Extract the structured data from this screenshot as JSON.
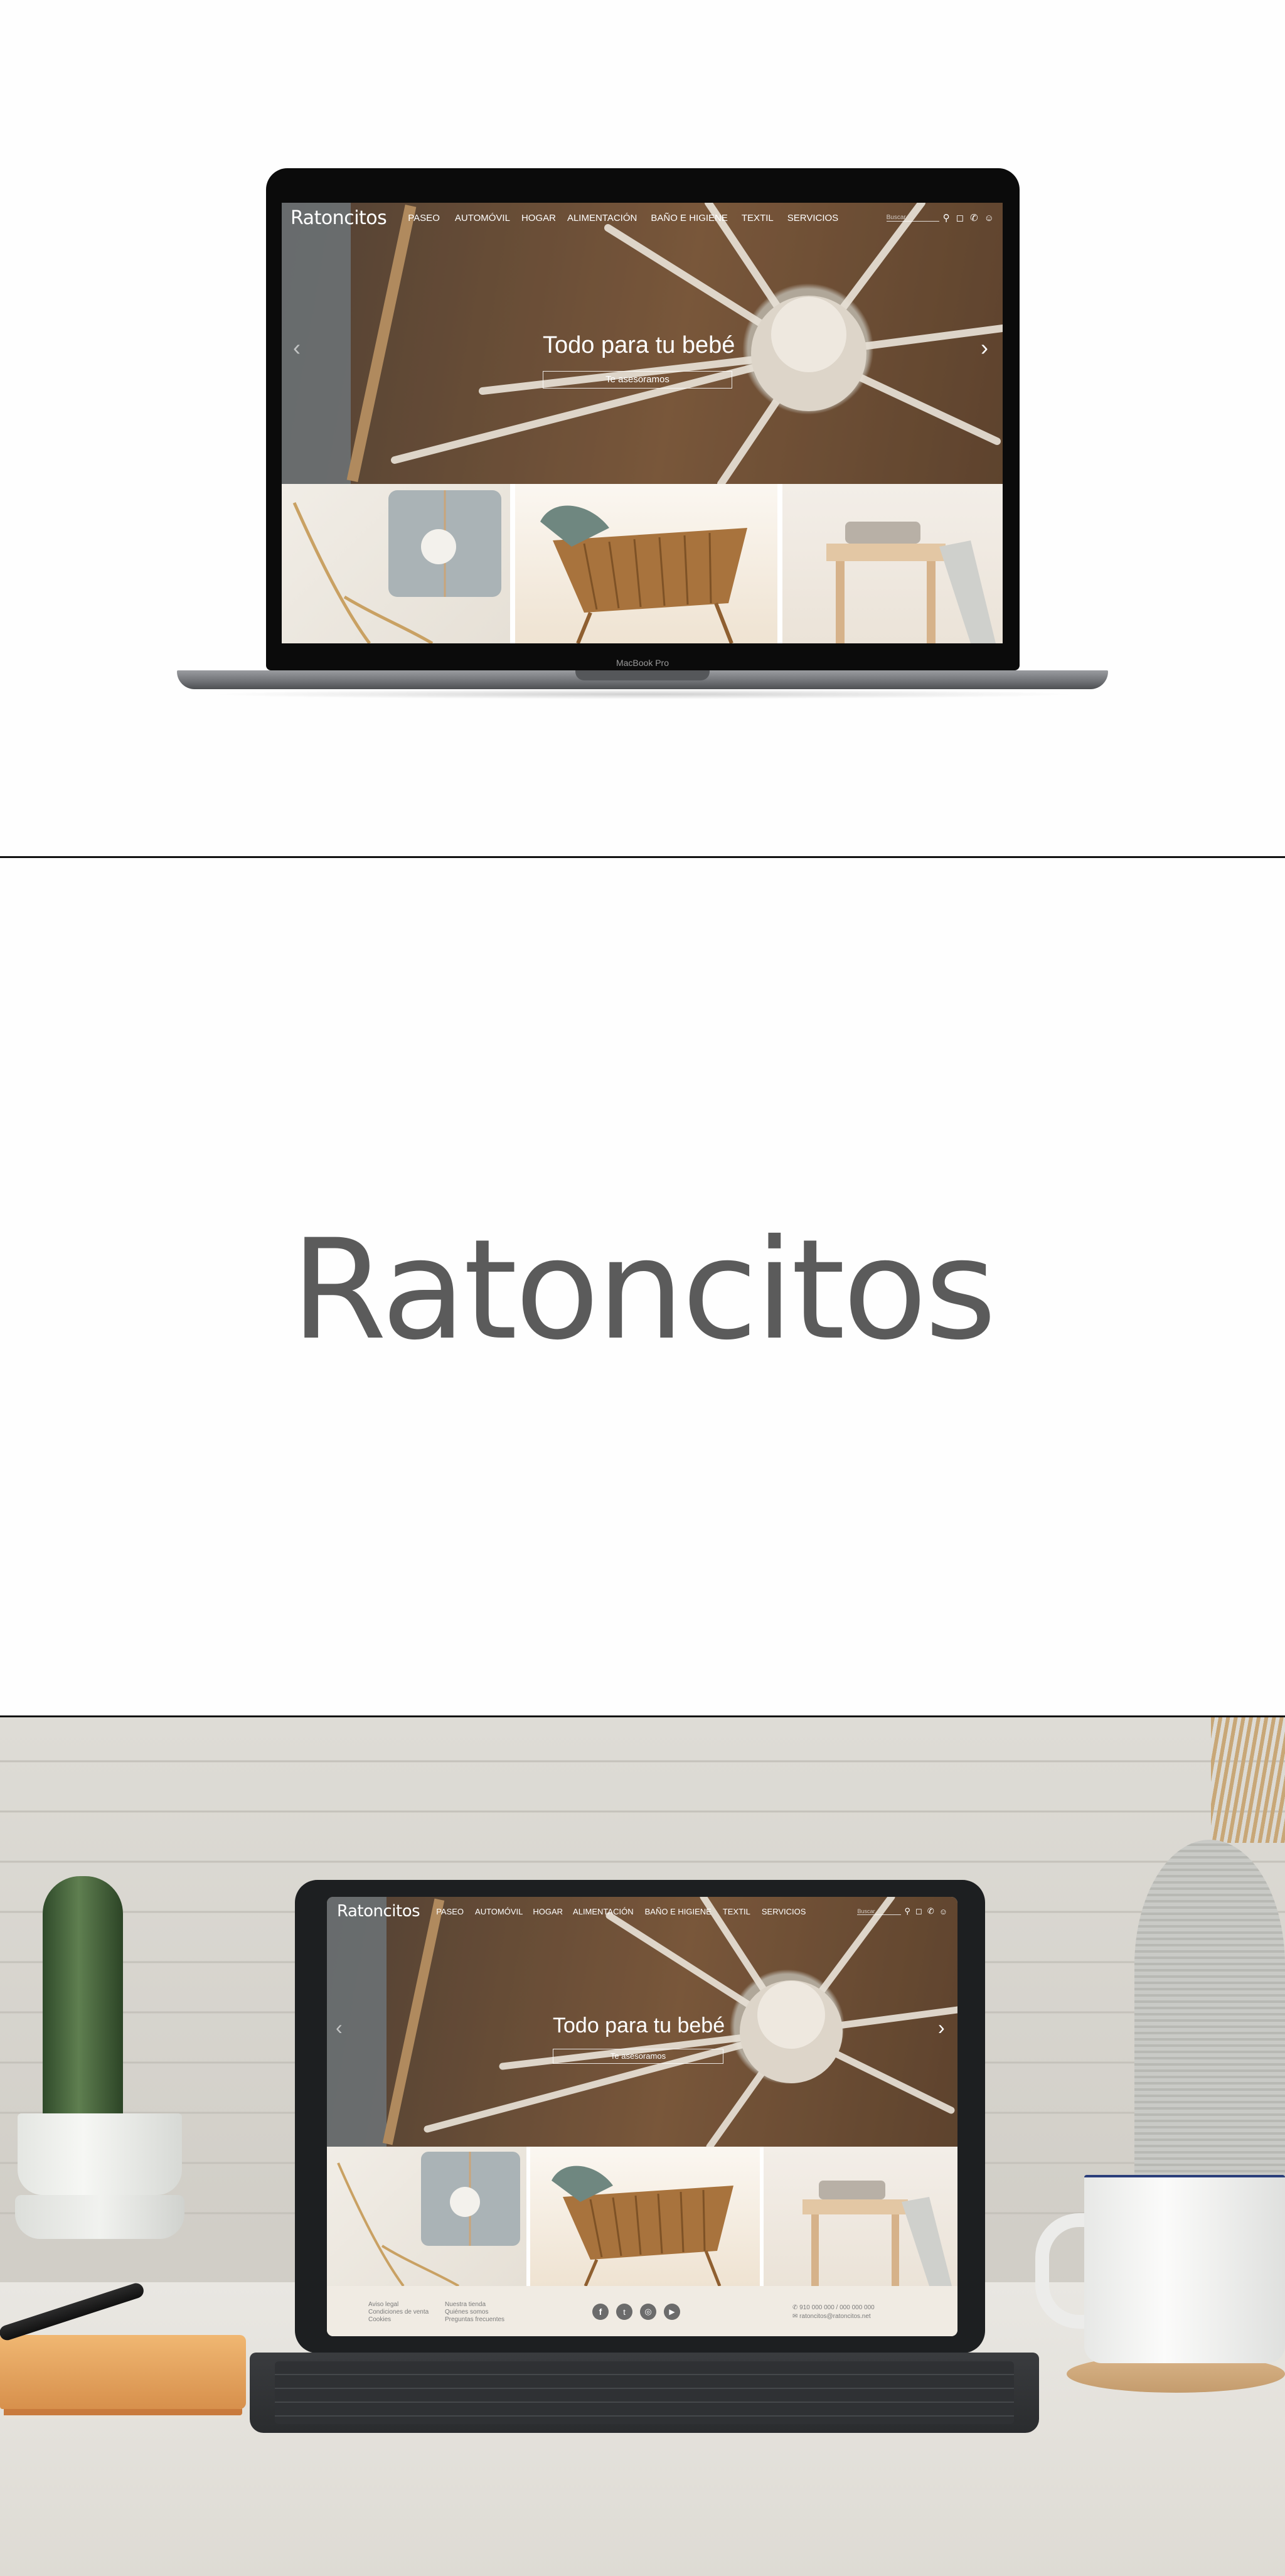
{
  "site": {
    "brand": "Ratoncitos",
    "menu": [
      "PASEO",
      "AUTOMÓVIL",
      "HOGAR",
      "ALIMENTACIÓN",
      "BAÑO E HIGIENE",
      "TEXTIL",
      "SERVICIOS"
    ],
    "search_placeholder": "Buscar",
    "hero_title": "Todo para tu bebé",
    "hero_button": "Te asesoramos",
    "prev_arrow": "‹",
    "next_arrow": "›",
    "icons": [
      "search-icon",
      "bag-icon",
      "phone-icon",
      "user-icon"
    ]
  },
  "laptop": {
    "model_label": "MacBook Pro"
  },
  "logo_panel": {
    "wordmark": "Ratoncitos"
  },
  "footer": {
    "col1": [
      "Aviso legal",
      "Condiciones de venta",
      "Cookies"
    ],
    "col2": [
      "Nuestra tienda",
      "Quiénes somos",
      "Preguntas frecuentes"
    ],
    "social_icons": [
      "facebook-icon",
      "twitter-icon",
      "instagram-icon",
      "youtube-icon"
    ],
    "phone": "910 000 000 / 000 000 000",
    "email": "ratoncitos@ratoncitos.net"
  },
  "colors": {
    "hero_brown": "#7a5a40",
    "logo_gray": "#5b5b5b",
    "footer_bg": "#f0ebe3"
  }
}
